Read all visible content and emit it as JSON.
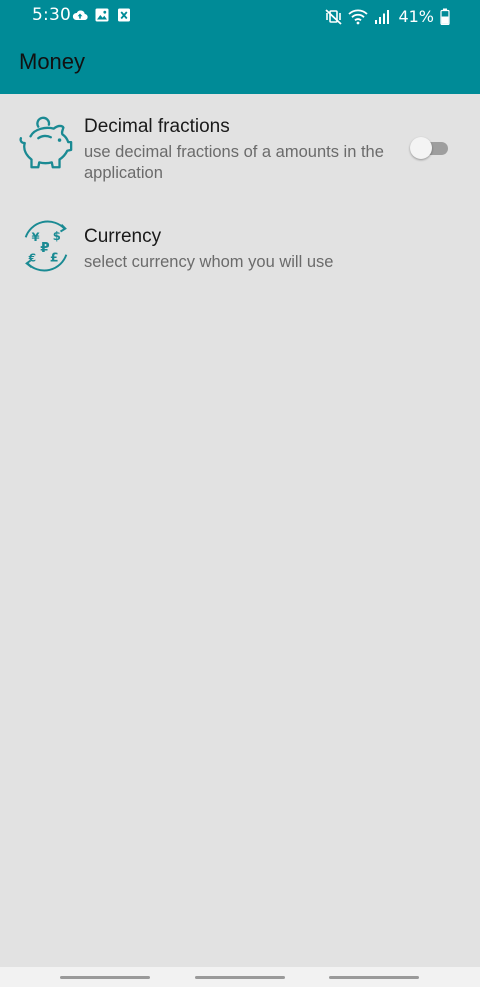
{
  "status_bar": {
    "time": "5:30",
    "battery": "41%",
    "left_icons": [
      "cloud-upload-icon",
      "image-icon",
      "excel-file-icon"
    ],
    "right_icons": [
      "mute-vibrate-icon",
      "wifi-icon",
      "signal-icon",
      "battery-icon"
    ]
  },
  "app_bar": {
    "title": "Money"
  },
  "preferences": [
    {
      "title": "Decimal fractions",
      "summary": "use decimal fractions of a amounts in the application",
      "icon": "piggy-bank-icon",
      "switch_on": false
    },
    {
      "title": "Currency",
      "summary": "select currency whom you will use",
      "icon": "currency-exchange-icon"
    }
  ],
  "colors": {
    "primary": "#008b97",
    "background": "#e2e2e2",
    "icon_tint": "#1a8a93"
  }
}
